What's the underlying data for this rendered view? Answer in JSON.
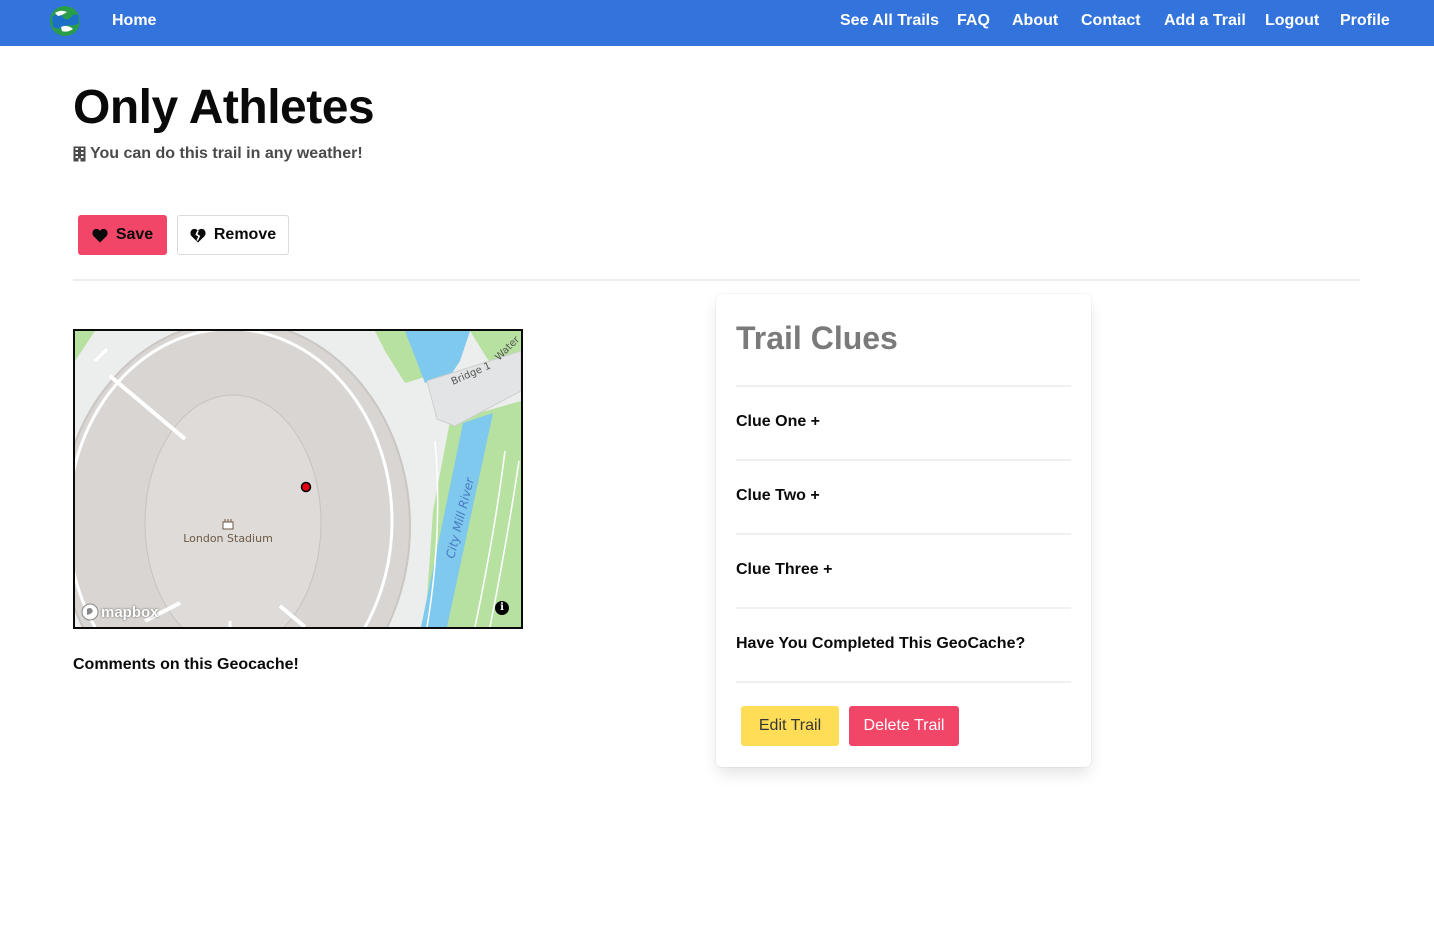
{
  "nav": {
    "home": "Home",
    "links": [
      "See All Trails",
      "FAQ",
      "About",
      "Contact",
      "Add a Trail",
      "Logout",
      "Profile"
    ]
  },
  "trail": {
    "title": "Only Athletes",
    "weather_note": "You can do this trail in any weather!"
  },
  "actions": {
    "save": "Save",
    "remove": "Remove"
  },
  "map": {
    "place_label": "London Stadium",
    "river_label": "City Mill River",
    "bridge_label": "Bridge 1",
    "water_label": "Water",
    "attribution": "mapbox",
    "info": "i"
  },
  "comments_heading": "Comments on this Geocache!",
  "clues": {
    "heading": "Trail Clues",
    "items": [
      "Clue One +",
      "Clue Two +",
      "Clue Three +",
      "Have You Completed This GeoCache?"
    ],
    "edit": "Edit Trail",
    "delete": "Delete Trail"
  },
  "colors": {
    "navbar": "#3273dc",
    "danger": "#f14668",
    "warning": "#ffdd57",
    "river": "#7fc8ee",
    "park": "#b7e1a1"
  }
}
